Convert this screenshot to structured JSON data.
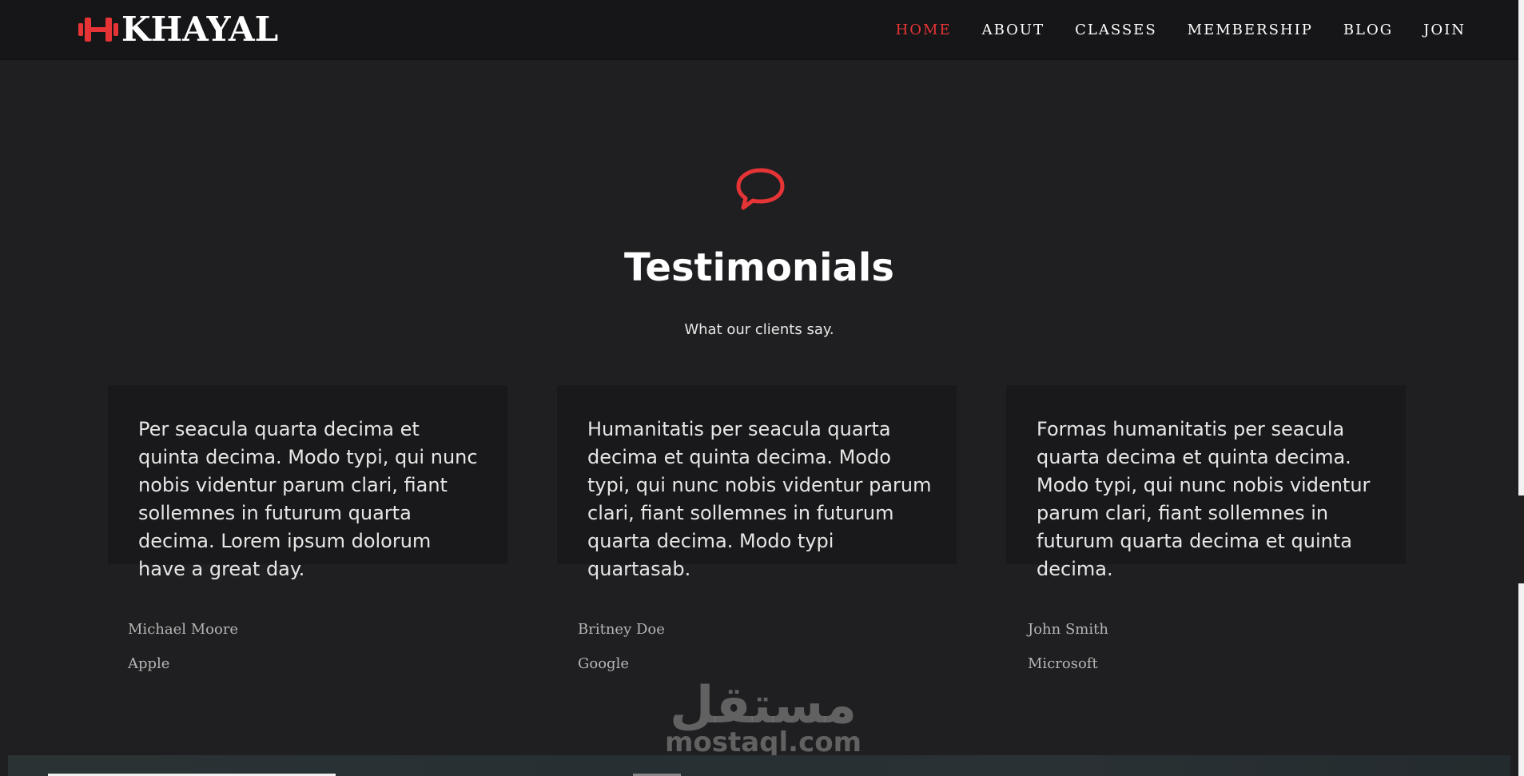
{
  "colors": {
    "accent": "#e63436",
    "background": "#1f1f21",
    "navbar": "#161618",
    "card": "#19191b"
  },
  "header": {
    "logo_text": "KHAYAL",
    "logo_icon": "dumbbell-icon",
    "nav": [
      {
        "label": "HOME",
        "active": true
      },
      {
        "label": "ABOUT",
        "active": false
      },
      {
        "label": "CLASSES",
        "active": false
      },
      {
        "label": "MEMBERSHIP",
        "active": false
      },
      {
        "label": "BLOG",
        "active": false
      },
      {
        "label": "JOIN",
        "active": false
      }
    ]
  },
  "testimonials": {
    "icon": "speech-bubble-icon",
    "title": "Testimonials",
    "subtitle": "What our clients say.",
    "items": [
      {
        "quote": "Per seacula quarta decima et quinta decima. Modo typi, qui nunc nobis videntur parum clari, fiant sollemnes in futurum quarta decima. Lorem ipsum dolorum have a great day.",
        "author": "Michael Moore",
        "company": "Apple"
      },
      {
        "quote": "Humanitatis per seacula quarta decima et quinta decima. Modo typi, qui nunc nobis videntur parum clari, fiant sollemnes in futurum quarta decima. Modo typi quartasab.",
        "author": "Britney Doe",
        "company": "Google"
      },
      {
        "quote": "Formas humanitatis per seacula quarta decima et quinta decima. Modo typi, qui nunc nobis videntur parum clari, fiant sollemnes in futurum quarta decima et quinta decima.",
        "author": "John Smith",
        "company": "Microsoft"
      }
    ]
  },
  "watermark": {
    "arabic": "مستقل",
    "latin": "mostaql.com"
  }
}
